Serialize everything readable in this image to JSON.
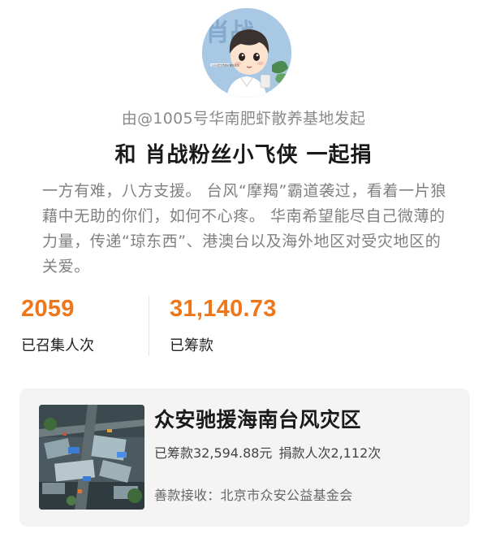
{
  "organizer": {
    "initiator_text": "由@1005号华南肥虾散养基地发起",
    "avatar_watermark": "1005号华南肥虾散养基地",
    "avatar_bg_glyph": "肖战"
  },
  "campaign": {
    "headline": "和 肖战粉丝小飞侠 一起捐",
    "description": "一方有难，八方支援。 台风“摩羯”霸道袭过，看着一片狼藉中无助的你们，如何不心疼。 华南希望能尽自己微薄的力量，传递“琼东西”、港澳台以及海外地区对受灾地区的关爱。"
  },
  "stats": {
    "participants": {
      "value": "2059",
      "label": "已召集人次"
    },
    "raised": {
      "value": "31,140.73",
      "label": "已筹款"
    }
  },
  "project": {
    "title": "众安驰援海南台风灾区",
    "raised_text": "已筹款32,594.88元",
    "donors_text": "捐款人次2,112次",
    "recipient_text": "善款接收：北京市众安公益基金会"
  },
  "colors": {
    "accent": "#f0761a",
    "card_bg": "#f4f4f4",
    "muted_text": "#808080"
  },
  "icons": {
    "avatar": "cartoon-boy-avatar",
    "project_thumbnail": "disaster-aerial-photo"
  }
}
